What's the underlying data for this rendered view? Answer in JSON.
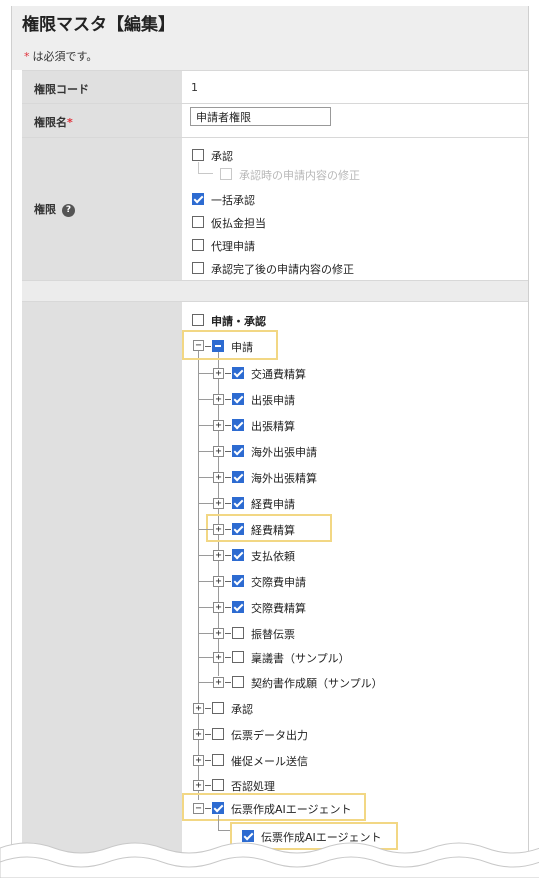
{
  "page": {
    "title": "権限マスタ【編集】",
    "required_star": "*",
    "required_note": "は必須です。"
  },
  "form": {
    "code": {
      "label": "権限コード",
      "value": "1"
    },
    "name": {
      "label": "権限名",
      "required_star": "*",
      "value": "申請者権限"
    },
    "permissions": {
      "label": "権限",
      "help_icon": "?",
      "items": [
        {
          "label": "承認",
          "checked": false
        },
        {
          "label": "承認時の申請内容の修正",
          "checked": false,
          "disabled": true
        },
        {
          "label": "一括承認",
          "checked": true
        },
        {
          "label": "仮払金担当",
          "checked": false
        },
        {
          "label": "代理申請",
          "checked": false
        },
        {
          "label": "承認完了後の申請内容の修正",
          "checked": false
        }
      ]
    }
  },
  "tree": {
    "root_label": "申請・承認",
    "toggle_expanded": "−",
    "toggle_collapsed": "+",
    "nodes": {
      "shinsei": {
        "label": "申請",
        "state": "partial",
        "expanded": true
      },
      "shinsei_children": [
        {
          "label": "交通費精算",
          "checked": true
        },
        {
          "label": "出張申請",
          "checked": true
        },
        {
          "label": "出張精算",
          "checked": true
        },
        {
          "label": "海外出張申請",
          "checked": true
        },
        {
          "label": "海外出張精算",
          "checked": true
        },
        {
          "label": "経費申請",
          "checked": true
        },
        {
          "label": "経費精算",
          "checked": true
        },
        {
          "label": "支払依頼",
          "checked": true
        },
        {
          "label": "交際費申請",
          "checked": true
        },
        {
          "label": "交際費精算",
          "checked": true
        },
        {
          "label": "振替伝票",
          "checked": false
        },
        {
          "label": "稟議書（サンプル）",
          "checked": false
        },
        {
          "label": "契約書作成願（サンプル）",
          "checked": false
        }
      ],
      "others": [
        {
          "label": "承認",
          "checked": false
        },
        {
          "label": "伝票データ出力",
          "checked": false
        },
        {
          "label": "催促メール送信",
          "checked": false
        },
        {
          "label": "否認処理",
          "checked": false
        }
      ],
      "ai": {
        "label": "伝票作成AIエージェント",
        "checked": true,
        "expanded": true
      },
      "ai_child": {
        "label": "伝票作成AIエージェント",
        "checked": true
      }
    }
  },
  "colors": {
    "accent": "#2d6bd1",
    "highlight": "#f2d784",
    "required": "#e0303a",
    "label_bg": "#e0e0e0",
    "header_bg": "#eeeeee"
  }
}
